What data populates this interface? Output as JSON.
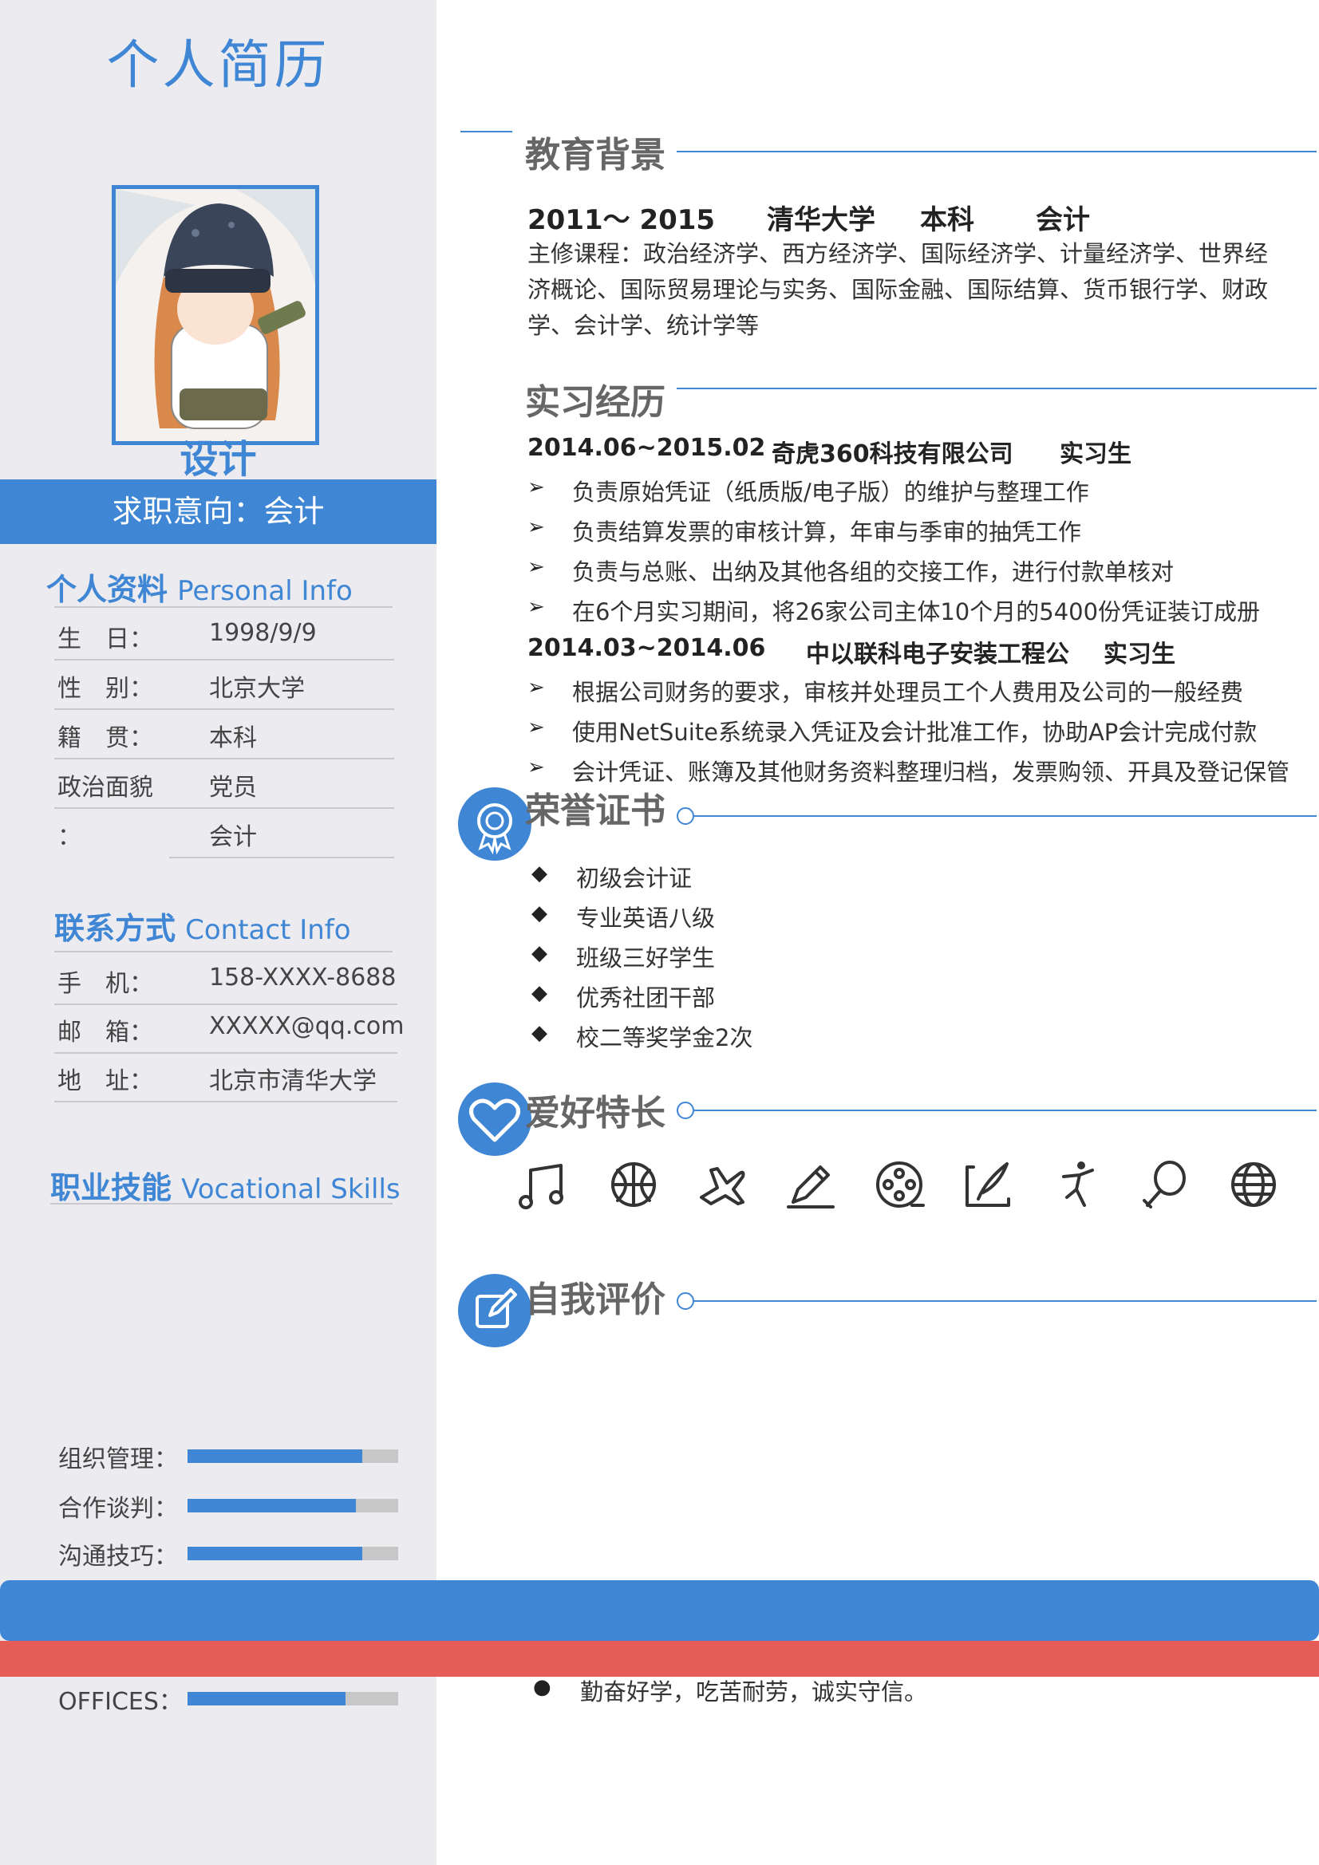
{
  "header": {
    "title": "个人简历",
    "photo_caption": "设计",
    "intent": "求职意向：会计"
  },
  "personal": {
    "heading_cn": "个人资料",
    "heading_en": "Personal Info",
    "rows": [
      {
        "label": "生　日：",
        "value": "1998/9/9"
      },
      {
        "label": "性　别：",
        "value": "北京大学"
      },
      {
        "label": "籍　贯：",
        "value": "本科"
      },
      {
        "label": "政治面貌",
        "value": "党员"
      },
      {
        "label": "：",
        "value": "会计"
      }
    ]
  },
  "contact": {
    "heading_cn": "联系方式",
    "heading_en": "Contact Info",
    "rows": [
      {
        "label": "手　机：",
        "value": "158-XXXX-8688"
      },
      {
        "label": "邮　箱：",
        "value": "XXXXX@qq.com"
      },
      {
        "label": "地　址：",
        "value": "北京市清华大学"
      }
    ]
  },
  "skills": {
    "heading_cn": "职业技能",
    "heading_en": "Vocational Skills",
    "items": [
      {
        "label": "组织管理：",
        "level": 0.83
      },
      {
        "label": "合作谈判：",
        "level": 0.8
      },
      {
        "label": "沟通技巧：",
        "level": 0.83
      },
      {
        "label": "OFFICES：",
        "level": 0.75
      }
    ]
  },
  "education": {
    "heading": "教育背景",
    "years": "2011～ 2015",
    "school": "清华大学",
    "degree": "本科",
    "major": "会计",
    "courses": "主修课程：政治经济学、西方经济学、国际经济学、计量经济学、世界经济概论、国际贸易理论与实务、国际金融、国际结算、货币银行学、财政学、会计学、统计学等"
  },
  "internship": {
    "heading": "实习经历",
    "jobs": [
      {
        "period": "2014.06~2015.02",
        "company": "奇虎360科技有限公司",
        "role": "实习生",
        "duties": [
          "负责原始凭证（纸质版/电子版）的维护与整理工作",
          "负责结算发票的审核计算，年审与季审的抽凭工作",
          "负责与总账、出纳及其他各组的交接工作，进行付款单核对",
          "在6个月实习期间，将26家公司主体10个月的5400份凭证装订成册"
        ]
      },
      {
        "period": "2014.03~2014.06",
        "company": "中以联科电子安装工程公",
        "role": "实习生",
        "duties": [
          "根据公司财务的要求，审核并处理员工个人费用及公司的一般经费",
          "使用NetSuite系统录入凭证及会计批准工作，协助AP会计完成付款",
          "会计凭证、账簿及其他财务资料整理归档，发票购领、开具及登记保管"
        ]
      }
    ]
  },
  "honors": {
    "heading": "荣誉证书",
    "items": [
      "初级会计证",
      "专业英语八级",
      "班级三好学生",
      "优秀社团干部",
      "校二等奖学金2次"
    ]
  },
  "hobbies": {
    "heading": "爱好特长",
    "icons": [
      "music-icon",
      "basketball-icon",
      "airplane-icon",
      "pen-icon",
      "film-reel-icon",
      "writing-icon",
      "dance-icon",
      "badminton-icon",
      "globe-icon"
    ]
  },
  "self_eval": {
    "heading": "自我评价",
    "items": [
      "勤奋好学，吃苦耐劳，诚实守信。"
    ]
  },
  "colors": {
    "accent": "#3f86d5",
    "sidebar": "#ecebef",
    "red": "#e65c57",
    "track": "#c7c7c7"
  }
}
